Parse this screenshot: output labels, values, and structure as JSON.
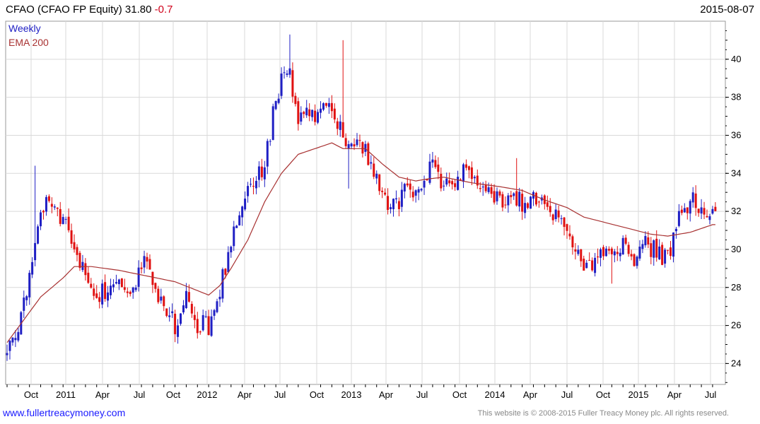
{
  "header": {
    "symbol": "CFAO (CFAO FP Equity) 31.80",
    "change": "-0.7",
    "date": "2015-08-07"
  },
  "legend": {
    "weekly": "Weekly",
    "ema": "EMA 200"
  },
  "footer": {
    "site": "www.fullertreacymoney.com",
    "copyright": "This website is © 2008-2015 Fuller Treacy Money plc. All rights reserved."
  },
  "colors": {
    "up": "#1f1fc4",
    "down": "#e01010",
    "ema": "#a83232",
    "grid": "#d9d9d9"
  },
  "chart_data": {
    "type": "candlestick",
    "x_ticks": [
      "Oct",
      "2011",
      "Apr",
      "Jul",
      "Oct",
      "2012",
      "Apr",
      "Jul",
      "Oct",
      "2013",
      "Apr",
      "Jul",
      "Oct",
      "2014",
      "Apr",
      "Jul",
      "Oct",
      "2015",
      "Apr",
      "Jul"
    ],
    "y_ticks": [
      24,
      26,
      28,
      30,
      32,
      34,
      36,
      38,
      40
    ],
    "ylim": [
      22.9,
      42.0
    ],
    "grid": true,
    "price_anchors": [
      [
        0,
        24.5
      ],
      [
        4,
        25.5
      ],
      [
        8,
        28.5
      ],
      [
        12,
        32.0
      ],
      [
        16,
        32.5
      ],
      [
        20,
        31.5
      ],
      [
        24,
        30.0
      ],
      [
        28,
        29.0
      ],
      [
        32,
        27.5
      ],
      [
        36,
        28.0
      ],
      [
        40,
        28.8
      ],
      [
        44,
        27.5
      ],
      [
        48,
        29.5
      ],
      [
        52,
        28.0
      ],
      [
        56,
        27.0
      ],
      [
        60,
        26.0
      ],
      [
        64,
        27.5
      ],
      [
        68,
        25.5
      ],
      [
        72,
        26.0
      ],
      [
        76,
        27.5
      ],
      [
        80,
        30.5
      ],
      [
        84,
        32.5
      ],
      [
        88,
        33.5
      ],
      [
        92,
        34.5
      ],
      [
        96,
        38.0
      ],
      [
        100,
        39.5
      ],
      [
        104,
        37.0
      ],
      [
        108,
        37.3
      ],
      [
        112,
        37.2
      ],
      [
        116,
        37.4
      ],
      [
        120,
        35.8
      ],
      [
        124,
        35.5
      ],
      [
        128,
        35.2
      ],
      [
        132,
        34.0
      ],
      [
        136,
        32.0
      ],
      [
        140,
        32.5
      ],
      [
        144,
        33.0
      ],
      [
        148,
        33.5
      ],
      [
        152,
        34.5
      ],
      [
        156,
        33.2
      ],
      [
        160,
        33.5
      ],
      [
        164,
        34.0
      ],
      [
        168,
        33.3
      ],
      [
        172,
        33.0
      ],
      [
        176,
        32.5
      ],
      [
        180,
        33.2
      ],
      [
        184,
        32.5
      ],
      [
        188,
        32.8
      ],
      [
        192,
        32.0
      ],
      [
        196,
        31.5
      ],
      [
        200,
        31.0
      ],
      [
        204,
        30.0
      ],
      [
        208,
        29.0
      ],
      [
        212,
        30.0
      ],
      [
        216,
        29.8
      ],
      [
        220,
        30.2
      ],
      [
        224,
        29.5
      ],
      [
        228,
        30.5
      ],
      [
        232,
        30.0
      ],
      [
        236,
        29.5
      ],
      [
        240,
        31.5
      ],
      [
        244,
        32.5
      ],
      [
        248,
        32.2
      ],
      [
        252,
        31.8
      ]
    ],
    "spikes": [
      {
        "week": 10,
        "high": 34.4
      },
      {
        "week": 94,
        "high": 35.8
      },
      {
        "week": 101,
        "high": 41.3
      },
      {
        "week": 120,
        "high": 41.0
      },
      {
        "week": 122,
        "low": 33.2
      },
      {
        "week": 182,
        "high": 34.8
      },
      {
        "week": 216,
        "low": 28.2
      }
    ],
    "ema": [
      [
        0,
        25.1
      ],
      [
        12,
        27.5
      ],
      [
        20,
        28.5
      ],
      [
        24,
        29.1
      ],
      [
        30,
        29.1
      ],
      [
        40,
        28.9
      ],
      [
        50,
        28.6
      ],
      [
        60,
        28.3
      ],
      [
        72,
        27.6
      ],
      [
        76,
        28.1
      ],
      [
        80,
        29.0
      ],
      [
        86,
        30.5
      ],
      [
        92,
        32.5
      ],
      [
        98,
        34.0
      ],
      [
        104,
        35.0
      ],
      [
        112,
        35.4
      ],
      [
        116,
        35.6
      ],
      [
        120,
        35.3
      ],
      [
        128,
        35.3
      ],
      [
        134,
        34.5
      ],
      [
        140,
        33.8
      ],
      [
        146,
        33.6
      ],
      [
        150,
        33.7
      ],
      [
        156,
        33.8
      ],
      [
        166,
        33.5
      ],
      [
        176,
        33.3
      ],
      [
        184,
        33.1
      ],
      [
        192,
        32.6
      ],
      [
        200,
        32.2
      ],
      [
        206,
        31.7
      ],
      [
        214,
        31.4
      ],
      [
        222,
        31.1
      ],
      [
        230,
        30.8
      ],
      [
        236,
        30.7
      ],
      [
        244,
        30.9
      ],
      [
        252,
        31.3
      ]
    ]
  }
}
